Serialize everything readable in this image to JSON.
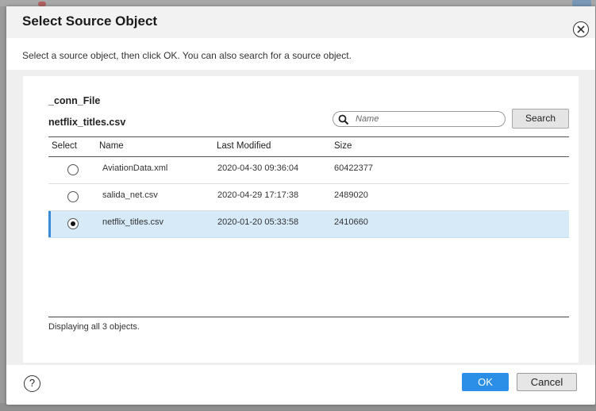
{
  "dialog": {
    "title": "Select Source Object",
    "instructions": "Select a source object, then click OK. You can also search for a source object."
  },
  "source": {
    "connection": "_conn_File",
    "selected_file": "netflix_titles.csv"
  },
  "search": {
    "placeholder": "Name",
    "value": "",
    "button_label": "Search",
    "icon": "search-icon"
  },
  "table": {
    "columns": [
      "Select",
      "Name",
      "Last Modified",
      "Size"
    ],
    "rows": [
      {
        "selected": false,
        "name": "AviationData.xml",
        "last_modified": "2020-04-30 09:36:04",
        "size": "60422377"
      },
      {
        "selected": false,
        "name": "salida_net.csv",
        "last_modified": "2020-04-29 17:17:38",
        "size": "2489020"
      },
      {
        "selected": true,
        "name": "netflix_titles.csv",
        "last_modified": "2020-01-20 05:33:58",
        "size": "2410660"
      }
    ],
    "footer": "Displaying all 3 objects."
  },
  "footer": {
    "help_label": "?",
    "ok_label": "OK",
    "cancel_label": "Cancel"
  },
  "colors": {
    "accent": "#2b8fe8",
    "selected_row": "#d7eaf8",
    "selected_bar": "#3a8ad6"
  }
}
